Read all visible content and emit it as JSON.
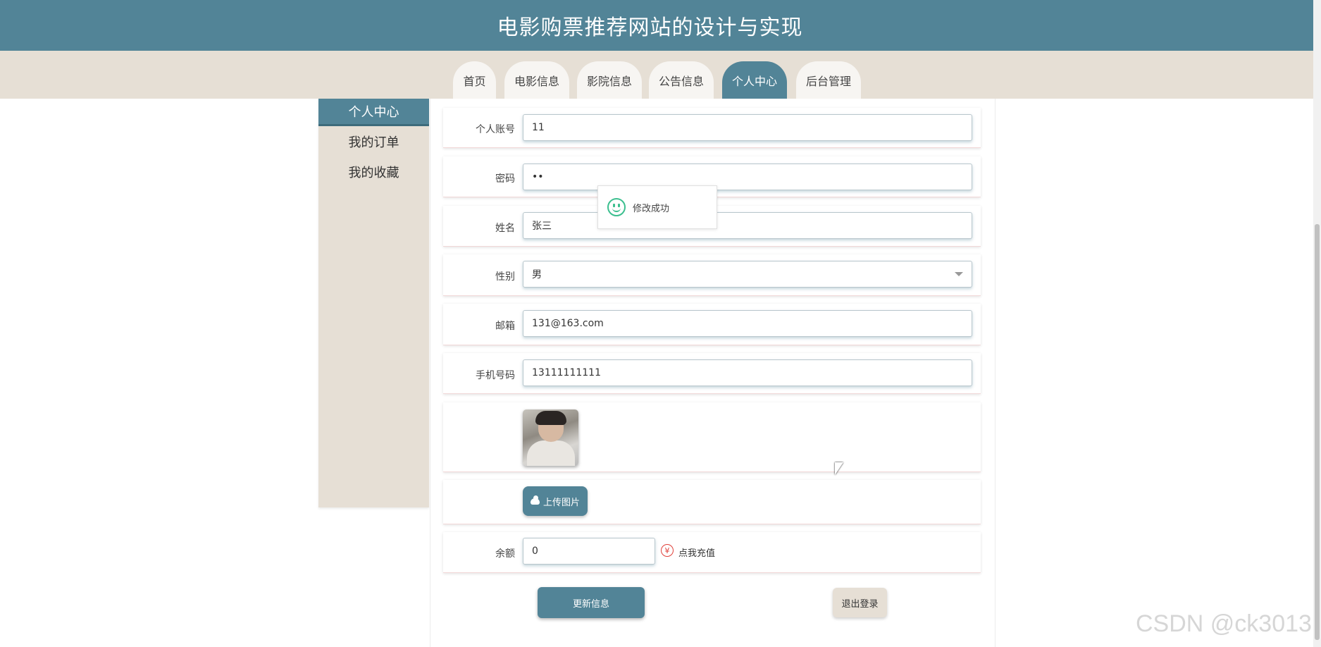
{
  "header": {
    "title": "电影购票推荐网站的设计与实现"
  },
  "nav": {
    "tabs": [
      {
        "label": "首页",
        "active": false
      },
      {
        "label": "电影信息",
        "active": false
      },
      {
        "label": "影院信息",
        "active": false
      },
      {
        "label": "公告信息",
        "active": false
      },
      {
        "label": "个人中心",
        "active": true
      },
      {
        "label": "后台管理",
        "active": false
      }
    ]
  },
  "sidebar": {
    "items": [
      {
        "label": "个人中心",
        "active": true
      },
      {
        "label": "我的订单",
        "active": false
      },
      {
        "label": "我的收藏",
        "active": false
      }
    ]
  },
  "form": {
    "account": {
      "label": "个人账号",
      "value": "11"
    },
    "password": {
      "label": "密码",
      "value": "••"
    },
    "name": {
      "label": "姓名",
      "value": "张三"
    },
    "gender": {
      "label": "性别",
      "value": "男"
    },
    "email": {
      "label": "邮箱",
      "value": "131@163.com"
    },
    "phone": {
      "label": "手机号码",
      "value": "13111111111"
    },
    "upload_label": "上传图片",
    "balance": {
      "label": "余额",
      "value": "0"
    },
    "recharge_icon": "¥",
    "recharge_label": "点我充值"
  },
  "toast": {
    "message": "修改成功",
    "icon": "smile-icon"
  },
  "actions": {
    "update_label": "更新信息",
    "logout_label": "退出登录"
  },
  "watermark": "CSDN @ck3013",
  "colors": {
    "primary": "#528497",
    "beige": "#e6dfd5",
    "success": "#3cbf8f",
    "danger": "#e0403a"
  }
}
